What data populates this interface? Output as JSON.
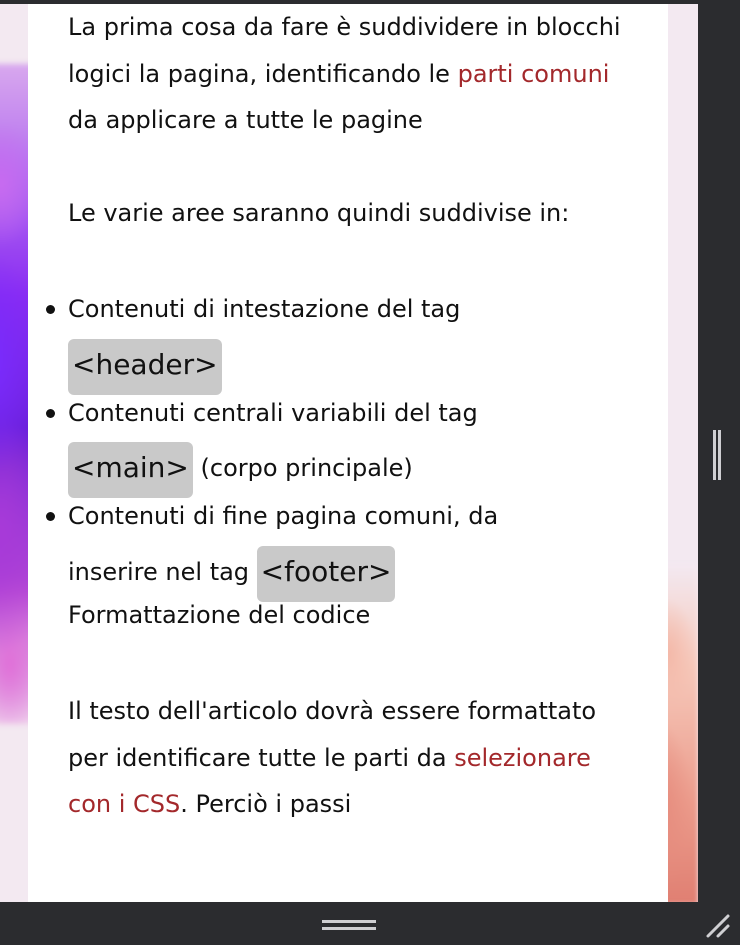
{
  "article": {
    "p1_a": "La prima cosa da fare è suddividere in blocchi logici la pagina, identificando le ",
    "p1_link": "parti comuni",
    "p1_b": " da applicare a tutte le pagine",
    "p2": "Le varie aree saranno quindi suddivise in:",
    "list": [
      {
        "text": "Contenuti di intestazione del tag",
        "code": "<header>",
        "after": ""
      },
      {
        "text": "Contenuti centrali variabili del tag",
        "code": "<main>",
        "after": " (corpo principale)"
      },
      {
        "text": "Contenuti di fine pagina comuni, da",
        "text2": "inserire nel tag ",
        "code": "<footer>"
      }
    ],
    "subheading": "Formattazione del codice",
    "p3_a": "Il testo dell'articolo dovrà essere formattato per identificare tutte le parti da ",
    "p3_link": "selezionare con i CSS",
    "p3_b": ". Perciò i passi"
  },
  "colors": {
    "link": "#a3282b",
    "code_bg": "#c9c9c9",
    "chrome": "#2b2c2f"
  },
  "icons": {
    "scrollbar": "vertical-scroll-handle",
    "bottom_grip": "horizontal-drag-handle",
    "resize": "resize-corner-icon"
  }
}
